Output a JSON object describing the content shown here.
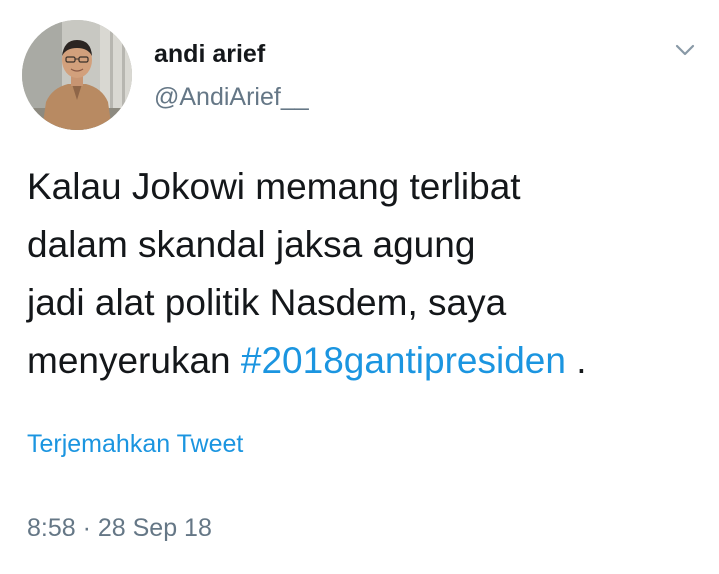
{
  "user": {
    "display_name": "andi arief",
    "handle": "@AndiArief__"
  },
  "tweet": {
    "line1": "Kalau Jokowi memang terlibat",
    "line2": "dalam skandal jaksa agung",
    "line3": "jadi alat politik Nasdem, saya",
    "line4_prefix": "menyerukan ",
    "hashtag": "#2018gantipresiden",
    "line4_suffix": " ."
  },
  "translate_label": "Terjemahkan Tweet",
  "timestamp": "8:58 · 28 Sep 18",
  "icons": {
    "menu": "chevron-down-icon"
  },
  "colors": {
    "link": "#1b95e0",
    "secondary_text": "#657786",
    "primary_text": "#14171a"
  }
}
